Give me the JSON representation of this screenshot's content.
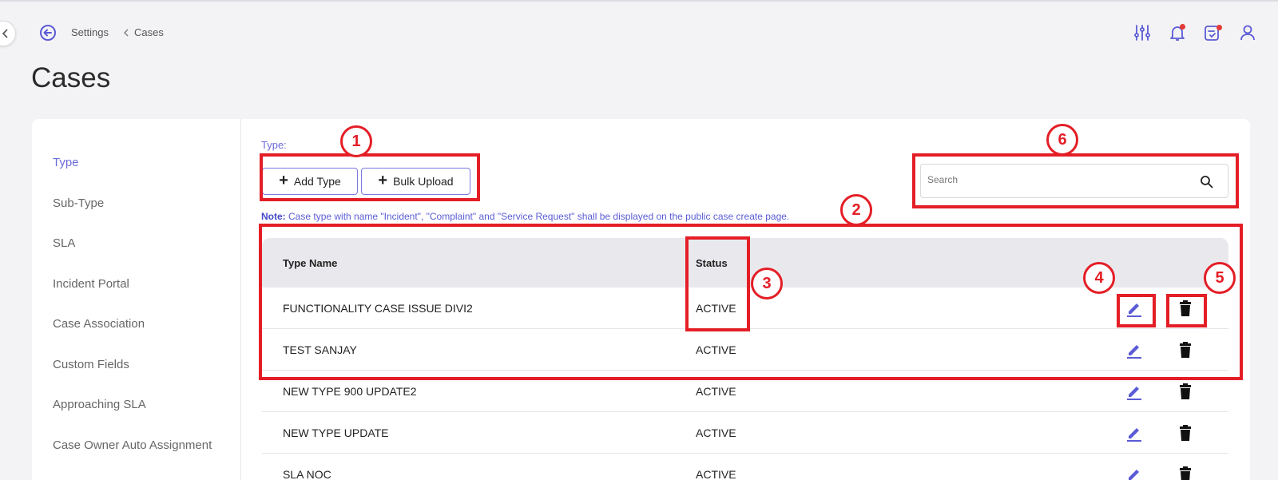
{
  "breadcrumb": {
    "parent": "Settings",
    "current": "Cases"
  },
  "header": {
    "icons": [
      "filter-sliders-icon",
      "bell-icon",
      "calendar-check-icon",
      "user-icon"
    ]
  },
  "page_title": "Cases",
  "sidebar": {
    "items": [
      {
        "label": "Type",
        "active": true
      },
      {
        "label": "Sub-Type"
      },
      {
        "label": "SLA"
      },
      {
        "label": "Incident Portal"
      },
      {
        "label": "Case Association"
      },
      {
        "label": "Custom Fields"
      },
      {
        "label": "Approaching SLA"
      },
      {
        "label": "Case Owner Auto Assignment"
      }
    ]
  },
  "main": {
    "type_label": "Type:",
    "add_type_label": "Add Type",
    "bulk_upload_label": "Bulk Upload",
    "note_prefix": "Note:",
    "note_text": " Case type with name \"Incident\", \"Complaint\" and \"Service Request\" shall be displayed on the public case create page.",
    "search_placeholder": "Search"
  },
  "table": {
    "columns": [
      "Type Name",
      "Status"
    ],
    "rows": [
      {
        "name": "FUNCTIONALITY CASE ISSUE DIVI2",
        "status": "ACTIVE"
      },
      {
        "name": "TEST SANJAY",
        "status": "ACTIVE"
      },
      {
        "name": "NEW TYPE 900 UPDATE2",
        "status": "ACTIVE"
      },
      {
        "name": "NEW TYPE UPDATE",
        "status": "ACTIVE"
      },
      {
        "name": "SLA NOC",
        "status": "ACTIVE"
      }
    ]
  },
  "annotations": [
    "1",
    "2",
    "3",
    "4",
    "5",
    "6"
  ],
  "colors": {
    "accent": "#6b6bd8",
    "annotation": "#e41e26",
    "notification_dot": "#e53935"
  }
}
